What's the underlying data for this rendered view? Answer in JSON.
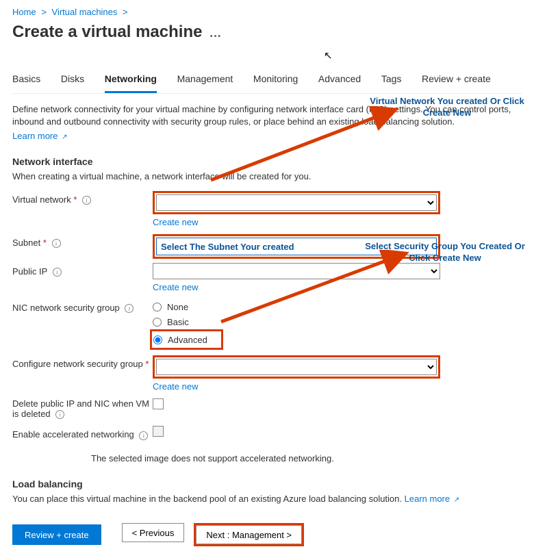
{
  "breadcrumb": {
    "home": "Home",
    "vms": "Virtual machines"
  },
  "title": "Create a virtual machine",
  "tabs": {
    "basics": "Basics",
    "disks": "Disks",
    "networking": "Networking",
    "management": "Management",
    "monitoring": "Monitoring",
    "advanced": "Advanced",
    "tags": "Tags",
    "review": "Review + create"
  },
  "intro": "Define network connectivity for your virtual machine by configuring network interface card (NIC) settings. You can control ports, inbound and outbound connectivity with security group rules, or place behind an existing load balancing solution.",
  "learn_more": "Learn more",
  "section_ni": "Network interface",
  "ni_desc": "When creating a virtual machine, a network interface will be created for you.",
  "labels": {
    "vnet": "Virtual network",
    "subnet": "Subnet",
    "pip": "Public IP",
    "nsg": "NIC network security group",
    "cfg_nsg": "Configure network security group",
    "delete": "Delete public IP and NIC when VM is deleted",
    "accel": "Enable accelerated networking"
  },
  "create_new": "Create new",
  "radios": {
    "none": "None",
    "basic": "Basic",
    "advanced": "Advanced"
  },
  "accel_note": "The selected image does not support accelerated networking.",
  "section_lb": "Load balancing",
  "lb_desc": "You can place this virtual machine in the backend pool of an existing Azure load balancing solution.",
  "buttons": {
    "review": "Review + create",
    "prev": "< Previous",
    "next": "Next : Management >"
  },
  "annotations": {
    "vnet": "Virtual Network You created Or Click Create New",
    "subnet_placeholder": "Select The Subnet Your created",
    "nsg": "Select Security Group You Created Or Click Create New"
  }
}
